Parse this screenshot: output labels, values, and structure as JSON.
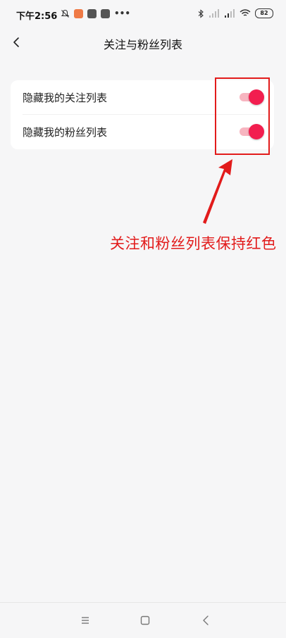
{
  "statusbar": {
    "time": "下午2:56",
    "battery": "82"
  },
  "header": {
    "title": "关注与粉丝列表"
  },
  "settings": {
    "items": [
      {
        "label": "隐藏我的关注列表",
        "enabled": true
      },
      {
        "label": "隐藏我的粉丝列表",
        "enabled": true
      }
    ]
  },
  "annotation": {
    "text": "关注和粉丝列表保持红色"
  },
  "colors": {
    "accent": "#f21e4f",
    "annotation": "#e21b1b"
  },
  "icons": {
    "back": "back-arrow-icon",
    "nav_menu": "menu-icon",
    "nav_home": "home-square-icon",
    "nav_back": "back-chevron-icon"
  }
}
